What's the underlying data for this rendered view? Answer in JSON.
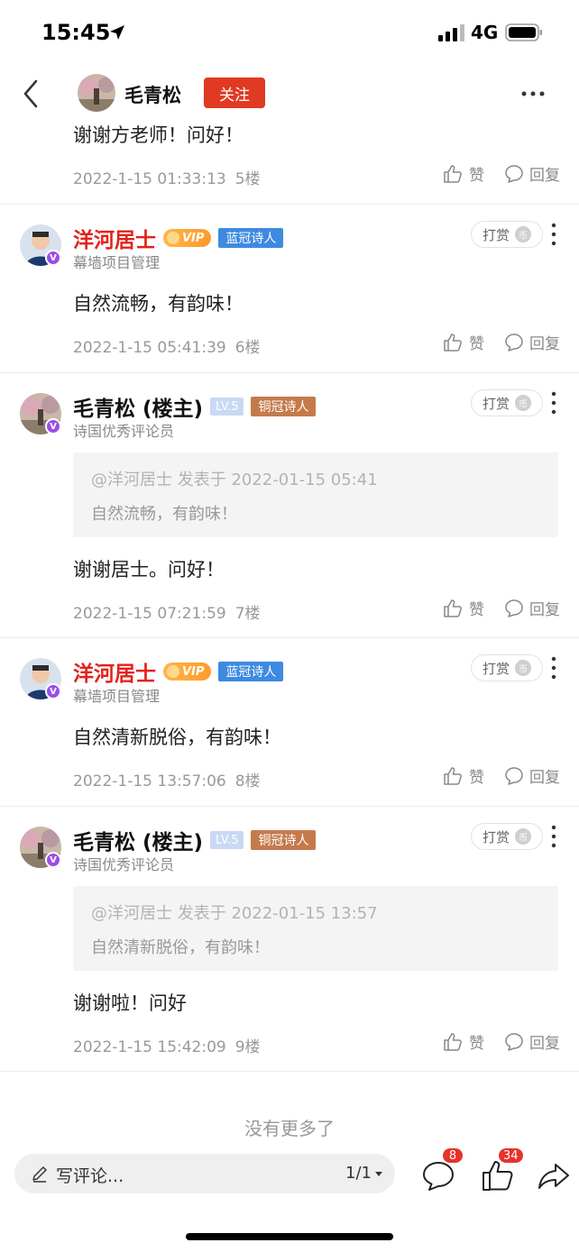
{
  "status_bar": {
    "time": "15:45",
    "network": "4G"
  },
  "nav": {
    "title_name": "毛青松",
    "follow_label": "关注"
  },
  "top_reply": {
    "text": "谢谢方老师！问好！",
    "date": "2022-1-15 01:33:13",
    "floor": "5楼"
  },
  "actions": {
    "like": "赞",
    "reply": "回复",
    "tip": "打赏",
    "tip_coin": "币"
  },
  "comments": [
    {
      "author": "洋河居士",
      "vip": "VIP",
      "tag": "蓝冠诗人",
      "subtitle": "幕墙项目管理",
      "text": "自然流畅，有韵味！",
      "date": "2022-1-15 05:41:39",
      "floor": "6楼"
    },
    {
      "author": "毛青松 (楼主)",
      "level": "LV.5",
      "tag": "铜冠诗人",
      "subtitle": "诗国优秀评论员",
      "quote_head": "@洋河居士 发表于 2022-01-15 05:41",
      "quote_body": "自然流畅，有韵味！",
      "text": "谢谢居士。问好！",
      "date": "2022-1-15 07:21:59",
      "floor": "7楼"
    },
    {
      "author": "洋河居士",
      "vip": "VIP",
      "tag": "蓝冠诗人",
      "subtitle": "幕墙项目管理",
      "text": "自然清新脱俗，有韵味！",
      "date": "2022-1-15 13:57:06",
      "floor": "8楼"
    },
    {
      "author": "毛青松 (楼主)",
      "level": "LV.5",
      "tag": "铜冠诗人",
      "subtitle": "诗国优秀评论员",
      "quote_head": "@洋河居士 发表于 2022-01-15 13:57",
      "quote_body": "自然清新脱俗，有韵味！",
      "text": "谢谢啦！问好",
      "date": "2022-1-15 15:42:09",
      "floor": "9楼"
    }
  ],
  "footer": {
    "no_more": "没有更多了"
  },
  "bottom_bar": {
    "placeholder": "写评论...",
    "page": "1/1",
    "comment_count": "8",
    "like_count": "34"
  },
  "colors": {
    "accent_red": "#e03a22",
    "tag_blue": "#3e8ae0",
    "tag_copper": "#c57a4b",
    "badge_purple": "#9b4de8"
  }
}
